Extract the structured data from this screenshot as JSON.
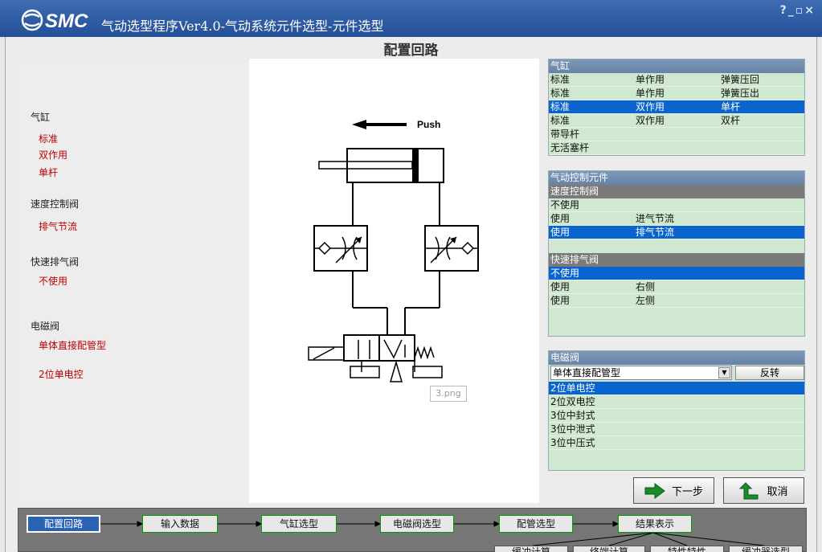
{
  "window": {
    "brand": "SMC",
    "title": "气动选型程序Ver4.0-气动系统元件选型-元件选型",
    "controls": "?_▫×"
  },
  "section_title": "配置回路",
  "summary": {
    "cylinder_label": "气缸",
    "cylinder_values": [
      "标准",
      "双作用",
      "单杆"
    ],
    "speed_label": "速度控制阀",
    "speed_value": "排气节流",
    "exhaust_label": "快速排气阀",
    "exhaust_value": "不使用",
    "valve_label": "电磁阀",
    "valve_type": "单体直接配管型",
    "valve_position": "2位单电控"
  },
  "diagram": {
    "push_label": "Push",
    "image_name": "3.png"
  },
  "cylinder_panel": {
    "header": "气缸",
    "rows": [
      [
        "标准",
        "单作用",
        "弹簧压回"
      ],
      [
        "标准",
        "单作用",
        "弹簧压出"
      ],
      [
        "标准",
        "双作用",
        "单杆"
      ],
      [
        "标准",
        "双作用",
        "双杆"
      ],
      [
        "带导杆",
        "",
        ""
      ],
      [
        "无活塞杆",
        "",
        ""
      ]
    ],
    "selected_index": 2
  },
  "control_panel": {
    "header": "气动控制元件",
    "speed_header": "速度控制阀",
    "speed_rows": [
      [
        "不使用",
        ""
      ],
      [
        "使用",
        "进气节流"
      ],
      [
        "使用",
        "排气节流"
      ]
    ],
    "speed_selected": 2,
    "exhaust_header": "快速排气阀",
    "exhaust_rows": [
      [
        "不使用",
        ""
      ],
      [
        "使用",
        "右侧"
      ],
      [
        "使用",
        "左侧"
      ]
    ],
    "exhaust_selected": 0
  },
  "valve_panel": {
    "header": "电磁阀",
    "combo_value": "单体直接配管型",
    "reverse_button": "反转",
    "rows": [
      "2位单电控",
      "2位双电控",
      "3位中封式",
      "3位中泄式",
      "3位中压式"
    ],
    "selected_index": 0
  },
  "buttons": {
    "next": "下一步",
    "cancel": "取消"
  },
  "flow": {
    "steps": [
      "配置回路",
      "输入数据",
      "气缸选型",
      "电磁阀选型",
      "配管选型",
      "结果表示"
    ],
    "sub_steps": [
      "缓冲计算",
      "终端计算",
      "特性特性",
      "缓冲器选型"
    ]
  },
  "colors": {
    "title_bar": "#2b5aa3",
    "selected_row": "#0a64d0",
    "list_bg": "#cfe8cf",
    "summary_value": "#c00000",
    "flow_border": "#00a000"
  }
}
